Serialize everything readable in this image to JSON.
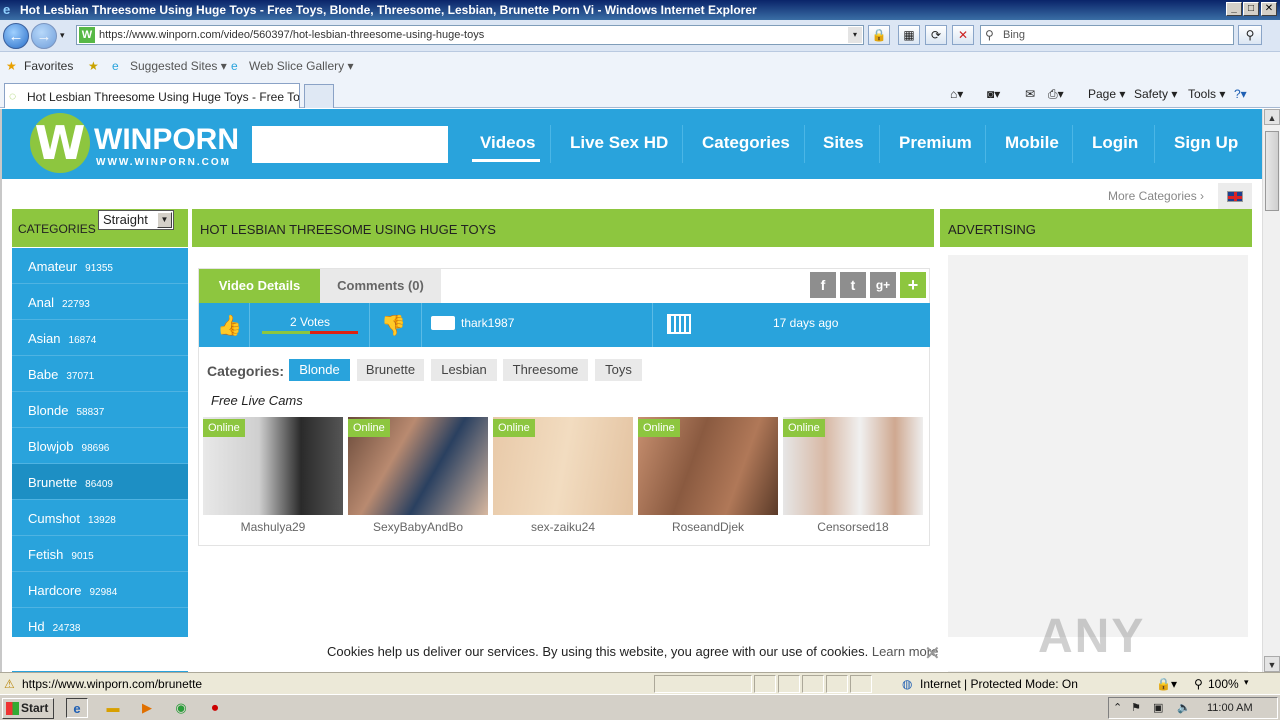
{
  "window": {
    "title": "Hot Lesbian Threesome Using Huge Toys - Free Toys, Blonde, Threesome, Lesbian, Brunette Porn Vi - Windows Internet Explorer",
    "controls": [
      "_",
      "□",
      "✕"
    ]
  },
  "address": {
    "url": "https://www.winporn.com/video/560397/hot-lesbian-threesome-using-huge-toys",
    "search_placeholder": "Bing"
  },
  "favorites": {
    "favorites_label": "Favorites",
    "suggested_label": "Suggested Sites ▾",
    "slice_label": "Web Slice Gallery ▾"
  },
  "tabs": {
    "active_title": "Hot Lesbian Threesome Using Huge Toys - Free Toys,...",
    "commands": [
      "Page ▾",
      "Safety ▾",
      "Tools ▾"
    ]
  },
  "site": {
    "logo_name": "WINPORN",
    "logo_sub": "WWW.WINPORN.COM",
    "nav": [
      "Videos",
      "Live Sex HD",
      "Categories",
      "Sites",
      "Premium",
      "Mobile",
      "Login",
      "Sign Up"
    ],
    "more_categories": "More Categories ›"
  },
  "sidebar": {
    "label": "CATEGORIES",
    "select_value": "Straight",
    "items": [
      {
        "name": "Amateur",
        "count": "91355"
      },
      {
        "name": "Anal",
        "count": "22793"
      },
      {
        "name": "Asian",
        "count": "16874"
      },
      {
        "name": "Babe",
        "count": "37071"
      },
      {
        "name": "Blonde",
        "count": "58837"
      },
      {
        "name": "Blowjob",
        "count": "98696"
      },
      {
        "name": "Brunette",
        "count": "86409"
      },
      {
        "name": "Cumshot",
        "count": "13928"
      },
      {
        "name": "Fetish",
        "count": "9015"
      },
      {
        "name": "Hardcore",
        "count": "92984"
      },
      {
        "name": "Hd",
        "count": "24738"
      }
    ]
  },
  "video": {
    "title": "HOT LESBIAN THREESOME USING HUGE TOYS",
    "tab_details": "Video Details",
    "tab_comments": "Comments (0)",
    "social": [
      "f",
      "t",
      "g+",
      "+"
    ],
    "votes": "2 Votes",
    "votes_positive_fraction": 0.5,
    "uploader": "thark1987",
    "age": "17 days ago",
    "categories_label": "Categories:",
    "categories": [
      "Blonde",
      "Brunette",
      "Lesbian",
      "Threesome",
      "Toys"
    ],
    "free_cams_label": "Free Live Cams",
    "online_label": "Online",
    "cams": [
      "Mashulya29",
      "SexyBabyAndBo",
      "sex-zaiku24",
      "RoseandDjek",
      "Censorsed18"
    ]
  },
  "ads": {
    "label": "ADVERTISING"
  },
  "cookie": {
    "text": "Cookies help us deliver our services. By using this website, you agree with our use of cookies.",
    "learn_more": "Learn more",
    "close": "✕"
  },
  "watermark": "ANY RUN",
  "status": {
    "url": "https://www.winporn.com/brunette",
    "zone": "Internet | Protected Mode: On",
    "zoom": "100%"
  },
  "taskbar": {
    "start": "Start",
    "clock": "11:00 AM"
  },
  "colors": {
    "accent_blue": "#29a3dc",
    "accent_green": "#8dc63f"
  }
}
